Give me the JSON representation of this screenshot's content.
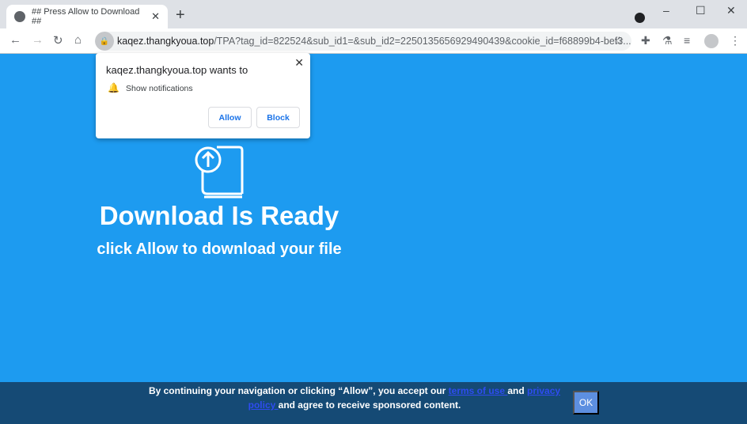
{
  "browser": {
    "tab_title": "## Press Allow to Download ##",
    "url_host": "kaqez.thangkyoua.top",
    "url_rest": "/TPA?tag_id=822524&sub_id1=&sub_id2=2250135656929490439&cookie_id=f68899b4-bef3..."
  },
  "popup": {
    "title": "kaqez.thangkyoua.top wants to",
    "permission": "Show notifications",
    "allow": "Allow",
    "block": "Block"
  },
  "page": {
    "heading": "Download Is Ready",
    "subheading": "click Allow to download your file",
    "accent": "#1d9bf0"
  },
  "footer": {
    "text1": "By continuing your navigation or clicking “Allow”, you accept our ",
    "terms": "terms of use ",
    "and": "and ",
    "privacy": "privacy policy ",
    "text2": "and agree to receive sponsored content.",
    "ok": "OK"
  }
}
